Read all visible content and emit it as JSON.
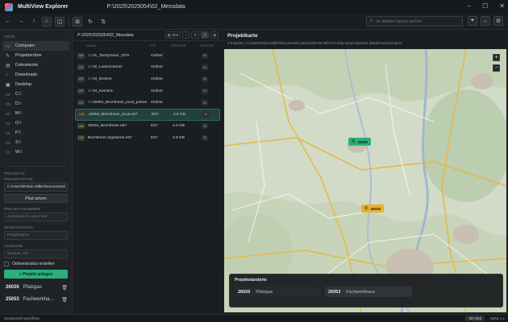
{
  "window": {
    "app_title": "MultiView Explorer",
    "path": "P:\\2025\\2025054\\02_Messdata"
  },
  "toolbar": {
    "search_placeholder": "Im aktiven Layout suchen",
    "icons": [
      "arrow-left-icon",
      "arrow-right-icon",
      "arrow-up-icon",
      "home-icon",
      "split-view-icon",
      "layout-icon",
      "refresh-icon",
      "sync-icon",
      "filter-icon",
      "sun-icon",
      "settings-icon"
    ]
  },
  "sidebar": {
    "section_title": "ORTE",
    "places": [
      {
        "label": "Computer",
        "icon": "monitor-icon"
      },
      {
        "label": "Projektordner",
        "icon": "paperclip-icon"
      },
      {
        "label": "Dokumente",
        "icon": "document-icon"
      },
      {
        "label": "Downloads",
        "icon": "download-icon"
      },
      {
        "label": "Desktop",
        "icon": "desktop-icon"
      },
      {
        "label": "C:\\",
        "icon": "drive-icon"
      },
      {
        "label": "D:\\",
        "icon": "drive-icon"
      },
      {
        "label": "M:\\",
        "icon": "drive-icon"
      },
      {
        "label": "O:\\",
        "icon": "drive-icon"
      },
      {
        "label": "P:\\",
        "icon": "drive-icon"
      },
      {
        "label": "S:\\",
        "icon": "drive-icon"
      },
      {
        "label": "W:\\",
        "icon": "drive-icon"
      }
    ],
    "projects_title": "PROJEKTE",
    "projektpfad_label": "PROJEKTPFAD",
    "projektpfad_value": "C:\\Users\\Robin Miller\\Documents\\",
    "pfad_setzen": "Pfad setzen",
    "projektnummer_label": "PROJEKTNUMMER",
    "projektnummer_placeholder": "Automatisch, wenn leer",
    "bezeichnung_label": "BEZEICHNUNG",
    "bezeichnung_placeholder": "Projektname",
    "adresse_label": "ADRESSE",
    "adresse_placeholder": "Strasse, Ort",
    "ordnerstruktur_label": "Ordnerstruktur erstellen",
    "projekt_anlegen": "+ Projekt anlegen",
    "projects": [
      {
        "id": "26026",
        "name": "Pfalzgas"
      },
      {
        "id": "25053",
        "name": "Fachwerkha..."
      }
    ]
  },
  "filepane": {
    "path": "P:\\2025\\2025054\\02_Messdata",
    "text_button": "Text",
    "columns": {
      "name": "NAME",
      "type": "TYP",
      "size": "GRÖSSE",
      "status": "STATUS"
    },
    "rows": [
      {
        "badge": "DIR",
        "name": "01_Tachymeter_GPS",
        "type": "Ordner",
        "size": "",
        "status": "0s",
        "selected": false
      },
      {
        "badge": "DIR",
        "name": "02_Laserscanner",
        "type": "Ordner",
        "size": "",
        "status": "0s",
        "selected": false
      },
      {
        "badge": "DIR",
        "name": "03_Drohne",
        "type": "Ordner",
        "size": "",
        "status": "0s",
        "selected": false
      },
      {
        "badge": "DIR",
        "name": "04_Kamera",
        "type": "Ordner",
        "size": "",
        "status": "0s",
        "selected": false
      },
      {
        "badge": "DIR",
        "name": "25054_Bechtheim_local_potree",
        "type": "Ordner",
        "size": "",
        "status": "0s",
        "selected": false
      },
      {
        "badge": "LAS",
        "name": "25054_Bechtheim_local.e57",
        "type": "E57",
        "size": "2.9 GB",
        "status": "30",
        "selected": true
      },
      {
        "badge": "LAS",
        "name": "25054_Bechtheim.e57",
        "type": "E57",
        "size": "4.0 GB",
        "status": "30",
        "selected": false
      },
      {
        "badge": "LAS",
        "name": "Bechtheim registered.e57",
        "type": "E57",
        "size": "2.9 GB",
        "status": "30",
        "selected": false
      }
    ]
  },
  "map": {
    "title": "Projektkarte",
    "subtitle": "2 Projekte | C:\\Users\\Robin Miller\\Documents\\Codex\\2026-05-29\\ich-m-chte-einen-windows-dateibrowser\\projects",
    "zoom_in": "+",
    "zoom_out": "−",
    "pins": [
      {
        "label": "25053",
        "color": "#2bb07a"
      },
      {
        "label": "26026",
        "color": "#e8b22f"
      }
    ],
    "overlay_title": "Projektstandorte",
    "overlay_items": [
      {
        "id": "26026",
        "name": "Pfalzgas"
      },
      {
        "id": "25053",
        "name": "Fachwerkhaus"
      }
    ]
  },
  "statusbar": {
    "left": "Startansicht geoeffnet.",
    "mode": "3D-Strd",
    "version": "Alpha 1.1"
  },
  "colors": {
    "accent": "#2bb07a",
    "pin_yellow": "#e8b22f",
    "background": "#1c1f22"
  }
}
